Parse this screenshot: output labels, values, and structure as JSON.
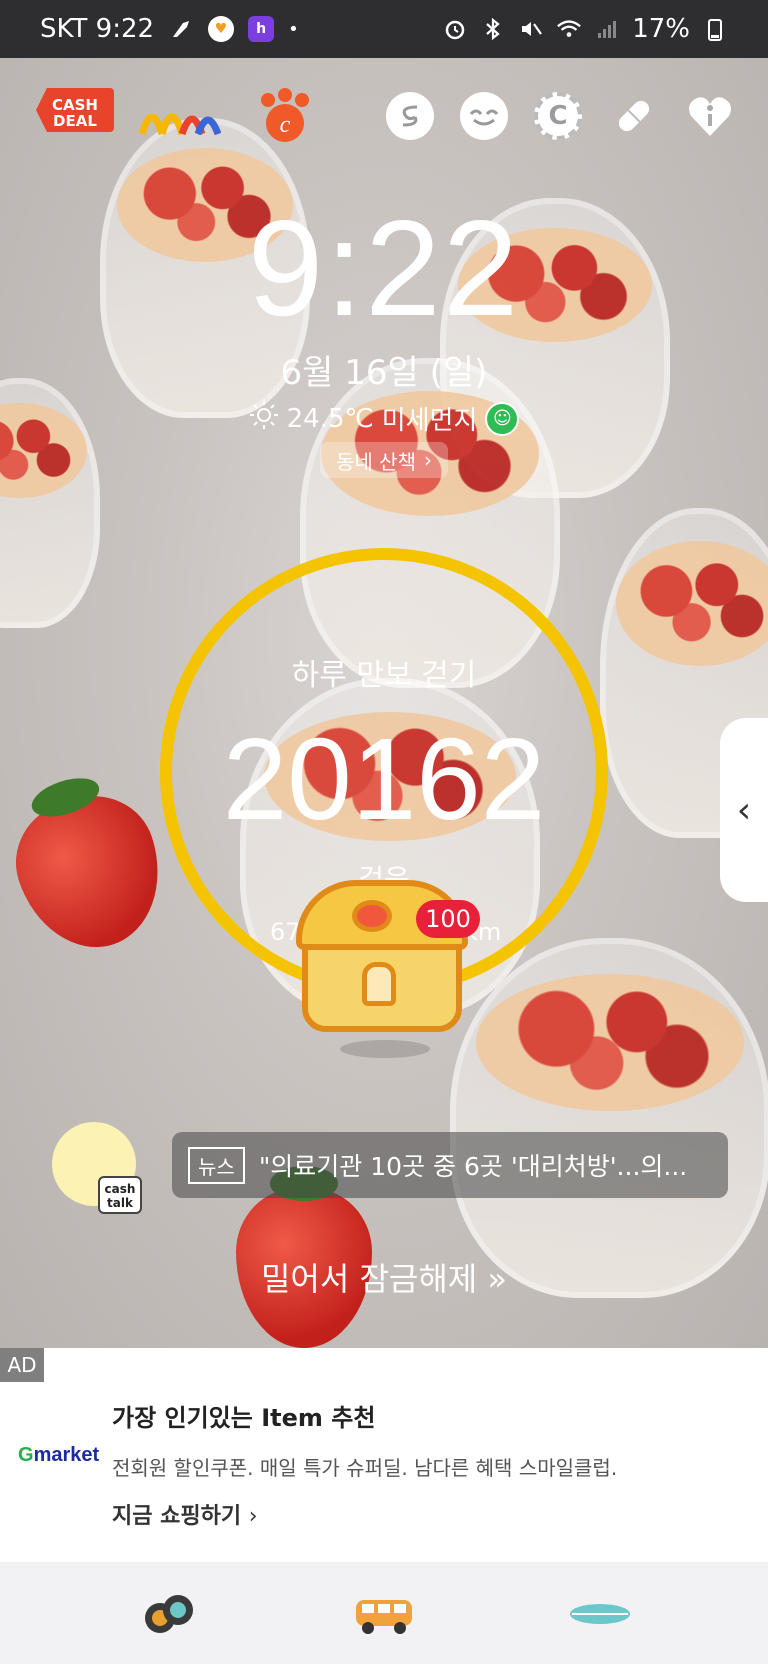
{
  "status_bar": {
    "carrier_time": "SKT 9:22",
    "app_badge_h": "h",
    "dot": "•",
    "battery": "17%"
  },
  "top_icons": {
    "cashdeal_label": "CASH\nDEAL",
    "coin_c": "C",
    "pill_icon": "pill-icon",
    "heart_info_icon": "heart-info-icon"
  },
  "lockscreen": {
    "time": "9:22",
    "date": "6월 16일 (일)",
    "temperature": "24.5℃",
    "dust_label": "미세먼지",
    "walk_button": "동네 산책"
  },
  "step_counter": {
    "title": "하루 만보 걷기",
    "steps": "20162",
    "unit": "걸음",
    "distance_prefix": "67",
    "distance_unit": "km",
    "reward_badge": "100",
    "ring_color": "#f5c400"
  },
  "news": {
    "tag": "뉴스",
    "headline": "\"의료기관 10곳 중 6곳 '대리처방'...의..."
  },
  "cashtalk": {
    "label": "cash\ntalk"
  },
  "unlock_hint": "밀어서 잠금해제",
  "ad": {
    "tag": "AD",
    "brand": "Gmarket",
    "title": "가장 인기있는 Item 추천",
    "description": "전회원 할인쿠폰. 매일 특가 슈퍼딜. 남다른 혜택 스마일클럽.",
    "cta": "지금 쇼핑하기"
  }
}
